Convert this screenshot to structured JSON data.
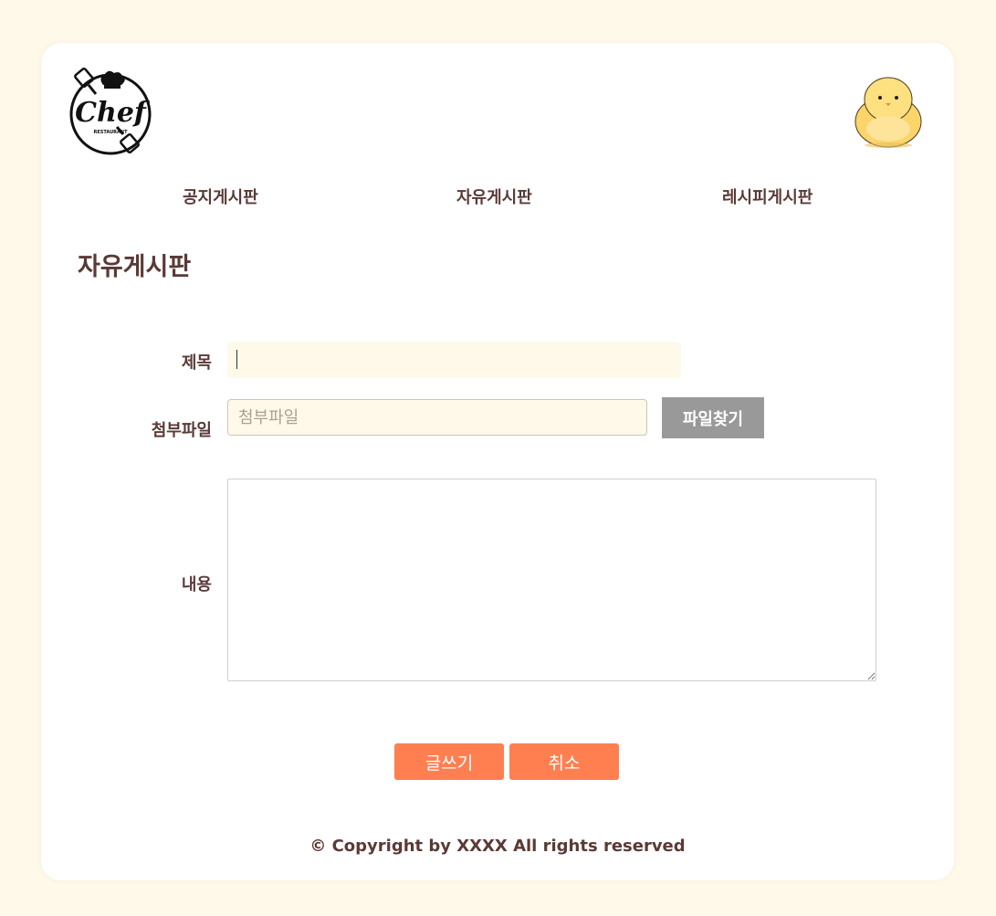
{
  "nav": {
    "items": [
      {
        "label": "공지게시판"
      },
      {
        "label": "자유게시판"
      },
      {
        "label": "레시피게시판"
      }
    ]
  },
  "logo": {
    "text": "Chef",
    "subtext": "RESTAURANT"
  },
  "page": {
    "title": "자유게시판"
  },
  "form": {
    "title_label": "제목",
    "title_value": "",
    "file_label": "첨부파일",
    "file_placeholder": "첨부파일",
    "file_button": "파일찾기",
    "content_label": "내용",
    "content_value": ""
  },
  "buttons": {
    "write": "글쓰기",
    "cancel": "취소"
  },
  "footer": {
    "copyright": "© Copyright by XXXX All rights reserved"
  },
  "colors": {
    "accent": "#ff7f50",
    "background": "#fff9ea",
    "text": "#5a3a36",
    "file_button": "#999999"
  },
  "icons": {
    "logo": "chef-logo-icon",
    "mascot": "chick-mascot-icon"
  }
}
